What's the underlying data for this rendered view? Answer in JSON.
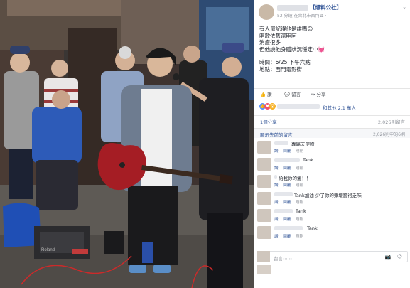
{
  "post": {
    "page_name": "【爆料公社】",
    "meta": "52 分鐘 在台北市西門區 ·",
    "menu_caret": "⌄",
    "lines": [
      "有人還記得他是誰嗎😊",
      "唱歌依舊還明阿",
      "消瘦很多",
      "但他說他身體狀況穩定中💓"
    ],
    "time_line": "時間：6/25 下午六點",
    "place_line": "地點：西門電影街"
  },
  "actions": {
    "like": "👍 讚",
    "comment": "💬 留言",
    "share": "↪ 分享"
  },
  "reactions": {
    "like_icon": "👍",
    "love_icon": "♥",
    "wow_icon": "😮",
    "others": "和其他 2.1 萬人"
  },
  "stats": {
    "shares": "1個分享",
    "seen": "2,026則留言"
  },
  "previous": {
    "label": "顯示先前的留言",
    "count": "2,026則中的6則"
  },
  "comments": [
    {
      "text": "專屬天使吻",
      "like": "讚",
      "reply": "回覆",
      "time": "剛剛"
    },
    {
      "text": "Tank",
      "like": "讚",
      "reply": "回覆",
      "time": "剛剛"
    },
    {
      "text": "給我你的愛！！",
      "like": "讚",
      "reply": "回覆",
      "time": "剛剛"
    },
    {
      "text": "Tank加油 少了你的樂壇變得乏味",
      "like": "讚",
      "reply": "回覆",
      "time": "剛剛"
    },
    {
      "text": "Tank",
      "like": "讚",
      "reply": "回覆",
      "time": "剛剛"
    },
    {
      "text": "Tank",
      "like": "讚",
      "reply": "回覆",
      "time": "剛剛"
    }
  ],
  "comment_box": {
    "placeholder": "留言⋯⋯",
    "icons": "📷 ☺"
  },
  "photo": {
    "amp_brand": "Roland"
  }
}
